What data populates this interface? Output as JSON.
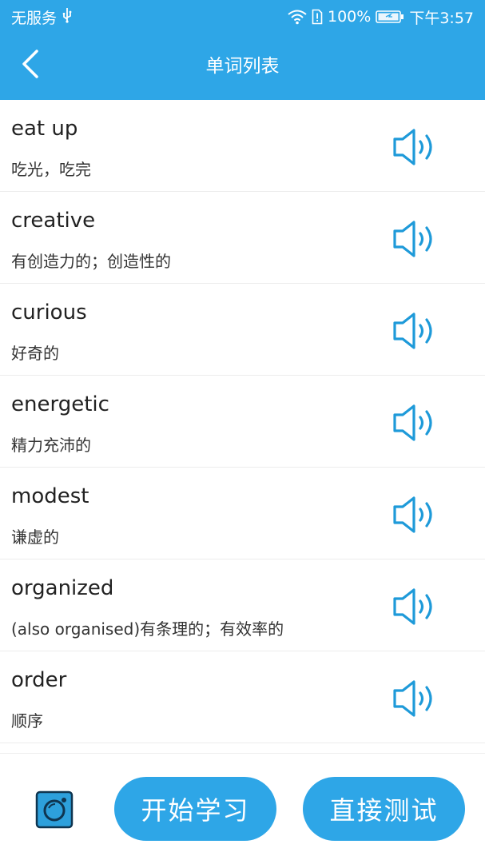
{
  "status_bar": {
    "carrier": "无服务",
    "battery_percent": "100%",
    "time": "下午3:57"
  },
  "header": {
    "title": "单词列表"
  },
  "words": [
    {
      "word": "eat up",
      "meaning": "吃光，吃完"
    },
    {
      "word": "creative",
      "meaning": "有创造力的；创造性的"
    },
    {
      "word": "curious",
      "meaning": "好奇的"
    },
    {
      "word": "energetic",
      "meaning": "精力充沛的"
    },
    {
      "word": "modest",
      "meaning": "谦虚的"
    },
    {
      "word": "organized",
      "meaning": "(also organised)有条理的；有效率的"
    },
    {
      "word": "order",
      "meaning": "顺序"
    }
  ],
  "bottom": {
    "start_label": "开始学习",
    "test_label": "直接测试"
  },
  "colors": {
    "primary": "#2ea6e7",
    "speaker": "#1e9ad9",
    "camera": "#2da0dc"
  },
  "icons": [
    "usb-icon",
    "wifi-icon",
    "sim-alert-icon",
    "battery-icon",
    "back-arrow-icon",
    "speaker-icon",
    "camera-icon"
  ]
}
